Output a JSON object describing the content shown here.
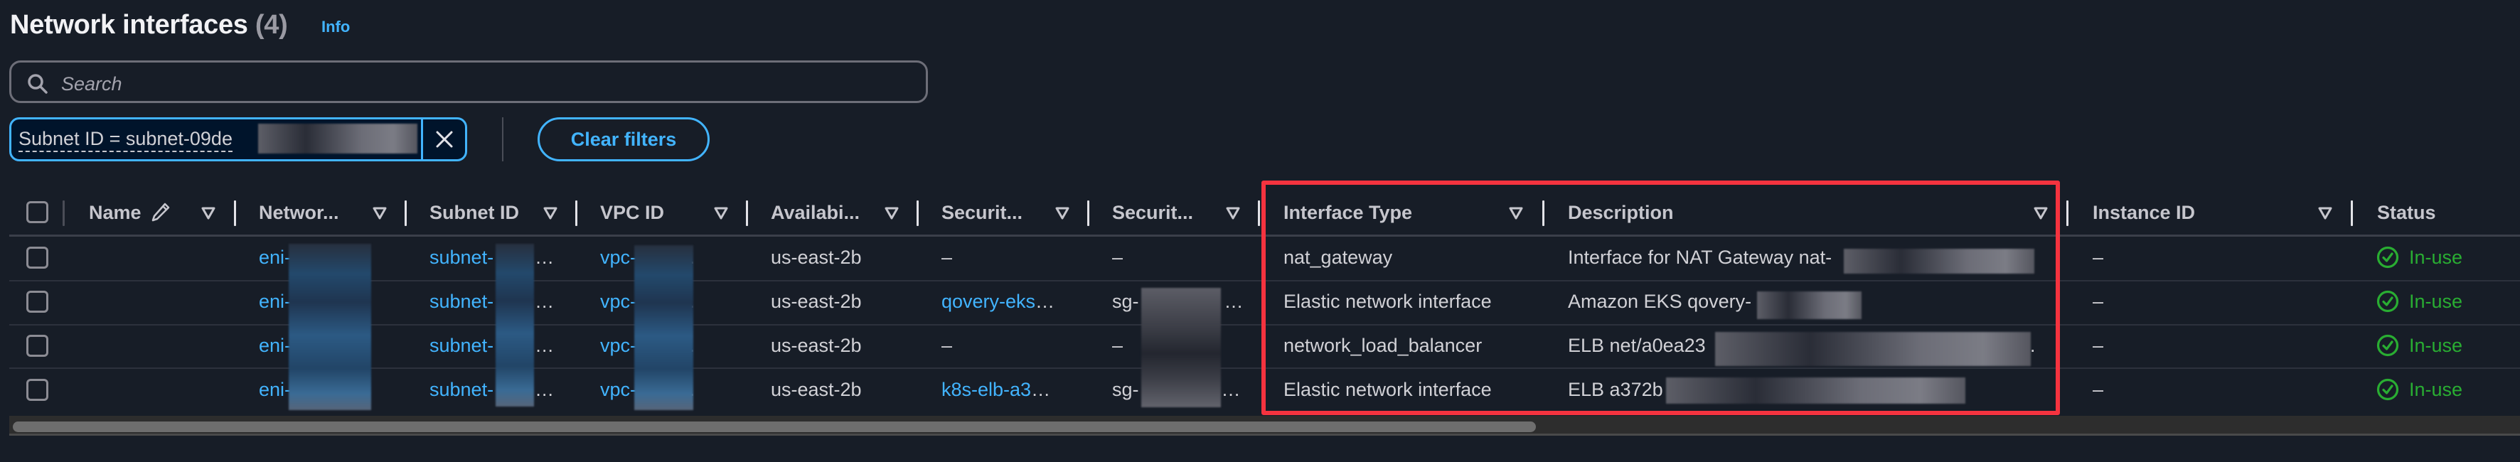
{
  "header": {
    "title": "Network interfaces",
    "count": "(4)",
    "info_link": "Info"
  },
  "search": {
    "placeholder": "Search",
    "value": ""
  },
  "filters": {
    "active": [
      {
        "label": "Subnet ID = subnet-09de",
        "value_redacted": true
      }
    ],
    "clear_label": "Clear filters"
  },
  "icons": {
    "search": "search-icon",
    "remove_filter": "close-icon",
    "sort": "sort-triangle-icon",
    "edit": "pencil-icon",
    "status_ok": "check-circle-icon"
  },
  "colors": {
    "accent": "#42b4ff",
    "success": "#29ad32",
    "highlight": "#f5333f",
    "background": "#171d27"
  },
  "table": {
    "columns": [
      {
        "label": "Name",
        "editable": true,
        "sortable": true
      },
      {
        "label": "Networ...",
        "sortable": true
      },
      {
        "label": "Subnet ID",
        "sortable": true
      },
      {
        "label": "VPC ID",
        "sortable": true
      },
      {
        "label": "Availabi...",
        "sortable": true
      },
      {
        "label": "Securit...",
        "sortable": true
      },
      {
        "label": "Securit...",
        "sortable": true
      },
      {
        "label": "Interface Type",
        "sortable": true
      },
      {
        "label": "Description",
        "sortable": true
      },
      {
        "label": "Instance ID",
        "sortable": true
      },
      {
        "label": "Status",
        "sortable": false
      }
    ],
    "rows": [
      {
        "name": "",
        "network_interface_id": "eni-",
        "subnet_id": "subnet-",
        "vpc_id": "vpc-",
        "availability_zone": "us-east-2b",
        "security_group_names": "–",
        "security_group_ids": "–",
        "interface_type": "nat_gateway",
        "description": "Interface for NAT Gateway nat-",
        "instance_id": "–",
        "status": "In-use"
      },
      {
        "name": "",
        "network_interface_id": "eni-",
        "subnet_id": "subnet-",
        "vpc_id": "vpc-",
        "availability_zone": "us-east-2b",
        "security_group_names": "qovery-eks",
        "security_group_ids": "sg-",
        "interface_type": "Elastic network interface",
        "description": "Amazon EKS qovery-",
        "instance_id": "–",
        "status": "In-use"
      },
      {
        "name": "",
        "network_interface_id": "eni-",
        "subnet_id": "subnet-",
        "vpc_id": "vpc-",
        "availability_zone": "us-east-2b",
        "security_group_names": "–",
        "security_group_ids": "–",
        "interface_type": "network_load_balancer",
        "description": "ELB net/a0ea23",
        "instance_id": "–",
        "status": "In-use"
      },
      {
        "name": "",
        "network_interface_id": "eni-",
        "subnet_id": "subnet-",
        "vpc_id": "vpc-",
        "availability_zone": "us-east-2b",
        "security_group_names": "k8s-elb-a3",
        "security_group_ids": "sg-",
        "interface_type": "Elastic network interface",
        "description": "ELB a372b",
        "instance_id": "–",
        "status": "In-use"
      }
    ],
    "ellipsis": "…",
    "highlighted_columns": [
      "Interface Type",
      "Description"
    ]
  }
}
